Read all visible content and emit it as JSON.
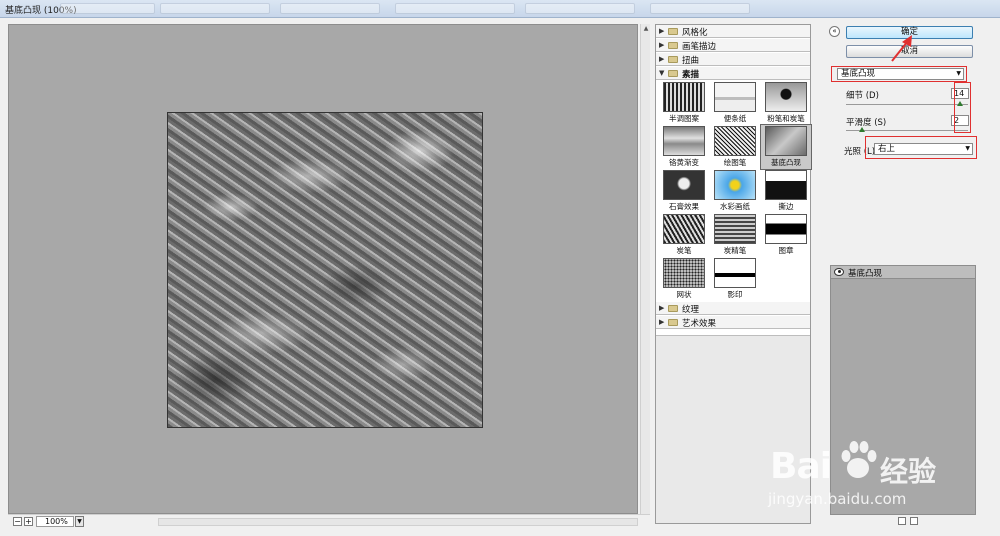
{
  "window": {
    "title": "基底凸现 (100%)"
  },
  "preview": {
    "zoom": "100%",
    "zoom_out": "−",
    "zoom_in": "+"
  },
  "gallery": {
    "categories": [
      {
        "label": "风格化",
        "expanded": false
      },
      {
        "label": "画笔描边",
        "expanded": false
      },
      {
        "label": "扭曲",
        "expanded": false
      },
      {
        "label": "素描",
        "expanded": true
      },
      {
        "label": "纹理",
        "expanded": false
      },
      {
        "label": "艺术效果",
        "expanded": false
      }
    ],
    "filters": [
      {
        "label": "半调图案"
      },
      {
        "label": "便条纸"
      },
      {
        "label": "粉笔和炭笔"
      },
      {
        "label": "铬黄渐变"
      },
      {
        "label": "绘图笔"
      },
      {
        "label": "基底凸现",
        "selected": true
      },
      {
        "label": "石膏效果"
      },
      {
        "label": "水彩画纸"
      },
      {
        "label": "撕边"
      },
      {
        "label": "炭笔"
      },
      {
        "label": "炭精笔"
      },
      {
        "label": "图章"
      },
      {
        "label": "网状"
      },
      {
        "label": "影印"
      }
    ]
  },
  "buttons": {
    "ok": "确定",
    "cancel": "取消",
    "collapse": "«"
  },
  "settings": {
    "filter_select": "基底凸现",
    "detail": {
      "label": "细节 (D)",
      "value": "14",
      "level": 14,
      "max": 15
    },
    "smoothness": {
      "label": "平滑度 (S)",
      "value": "2",
      "level": 2,
      "max": 15
    },
    "light": {
      "label": "光照 (L):",
      "value": "右上"
    }
  },
  "layers": {
    "items": [
      {
        "label": "基底凸现"
      }
    ]
  },
  "watermark": {
    "brand": "Bai",
    "suffix": "经验",
    "url": "jingyan.baidu.com"
  }
}
